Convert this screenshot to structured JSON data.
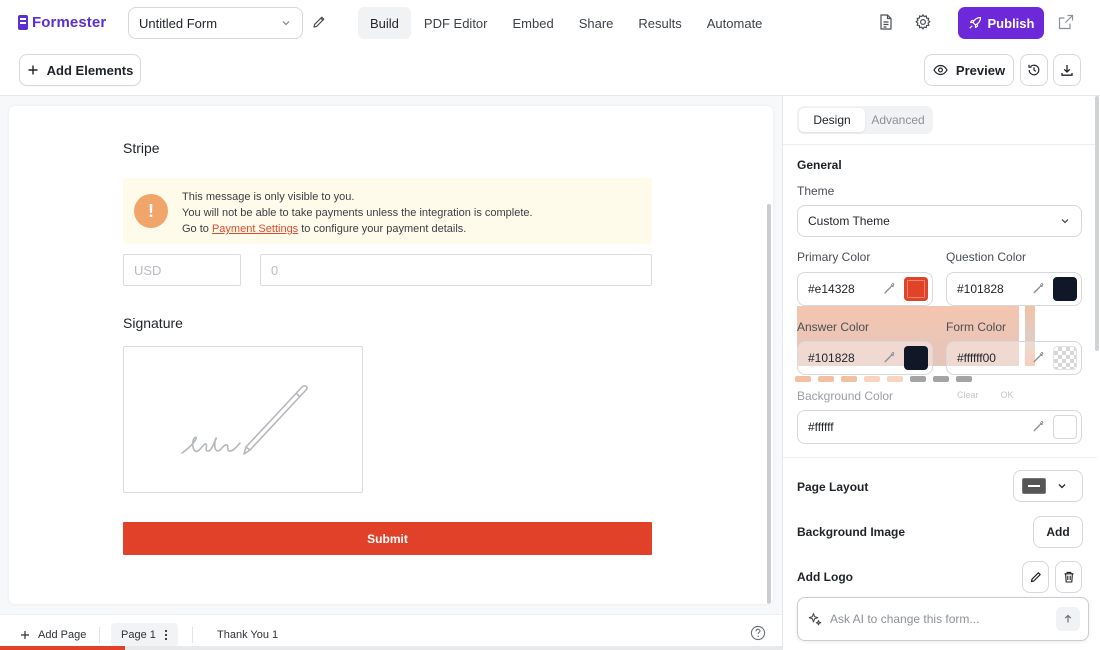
{
  "header": {
    "brand": "Formester",
    "form_name": "Untitled Form",
    "nav": [
      "Build",
      "PDF Editor",
      "Embed",
      "Share",
      "Results",
      "Automate"
    ],
    "active_nav": "Build",
    "publish_label": "Publish",
    "accent_color": "#6d28d9"
  },
  "toolbar": {
    "add_elements_label": "Add Elements",
    "preview_label": "Preview"
  },
  "form": {
    "stripe_title": "Stripe",
    "notice": {
      "line1": "This message is only visible to you.",
      "line2": "You will not be able to take payments unless the integration is complete.",
      "line3_prefix": "Go to ",
      "line3_link": "Payment Settings",
      "line3_suffix": " to configure your payment details."
    },
    "currency_placeholder": "USD",
    "amount_placeholder": "0",
    "signature_title": "Signature",
    "submit_label": "Submit",
    "submit_color": "#e04128"
  },
  "pages": {
    "add_page_label": "Add Page",
    "current_page": "Page 1",
    "thank_you_page": "Thank You 1",
    "progress_fraction": 0.16
  },
  "panel": {
    "tabs": [
      "Design",
      "Advanced"
    ],
    "active_tab": "Design",
    "general_heading": "General",
    "theme_label": "Theme",
    "theme_value": "Custom Theme",
    "primary_color_label": "Primary Color",
    "primary_color_value": "#e14328",
    "question_color_label": "Question Color",
    "question_color_value": "#101828",
    "answer_color_label": "Answer Color",
    "answer_color_value": "#101828",
    "form_color_label": "Form Color",
    "form_color_value": "#ffffff00",
    "background_color_label": "Background Color",
    "background_color_value": "#ffffff",
    "picker_clear_label": "Clear",
    "picker_ok_label": "OK",
    "page_layout_label": "Page Layout",
    "background_image_label": "Background Image",
    "add_label": "Add",
    "add_logo_label": "Add Logo",
    "ai_placeholder": "Ask AI to change this form..."
  }
}
